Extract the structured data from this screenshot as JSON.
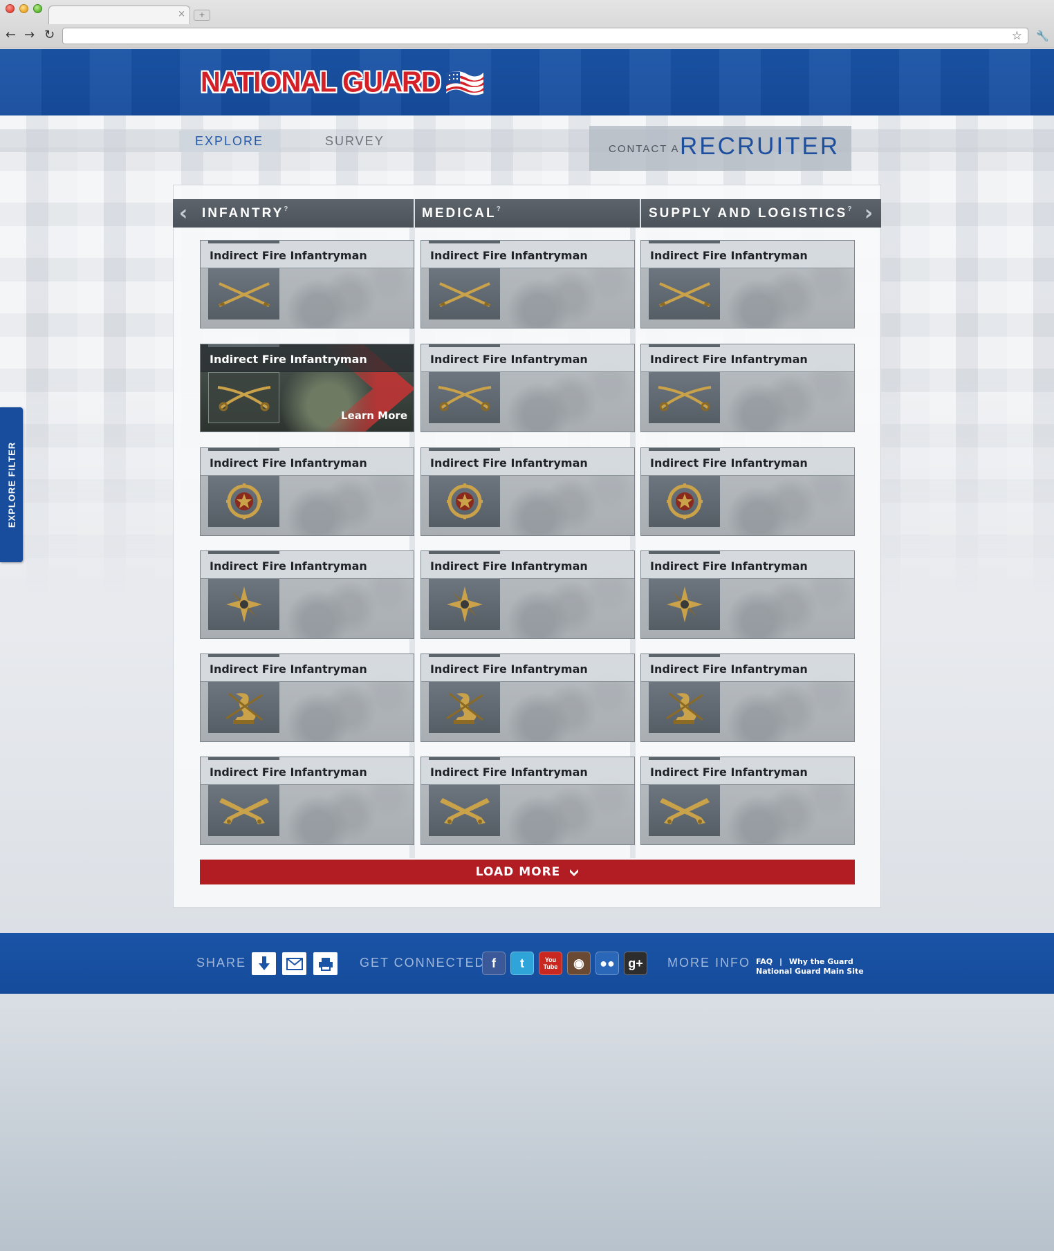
{
  "browser": {
    "tab_close": "×",
    "new_tab": "+",
    "nav_back": "←",
    "nav_forward": "→",
    "nav_reload": "↻",
    "bookmark": "☆",
    "wrench": "🔧"
  },
  "brand": {
    "logo_text": "NATIONAL GUARD",
    "red": "#d42027",
    "blue": "#1a54a6"
  },
  "nav": {
    "explore": "EXPLORE",
    "survey": "SURVEY",
    "contact_prefix": "CONTACT A",
    "recruiter": "RECRUITER"
  },
  "side_tab": {
    "label": "EXPLORE FILTER"
  },
  "categories": [
    {
      "label": "INFANTRY",
      "help": "?"
    },
    {
      "label": "MEDICAL",
      "help": "?"
    },
    {
      "label": "SUPPLY AND LOGISTICS",
      "help": "?"
    }
  ],
  "arrows": {
    "prev": "‹",
    "next": "›"
  },
  "cards": {
    "title": "Indirect Fire Infantryman",
    "active_learn_more": "Learn More",
    "rows": [
      {
        "icon": "crossed-rifles-icon"
      },
      {
        "icon": "crossed-sabers-icon"
      },
      {
        "icon": "ordnance-wheel-insignia-icon"
      },
      {
        "icon": "compass-star-insignia-icon"
      },
      {
        "icon": "signal-corps-insignia-icon"
      },
      {
        "icon": "crossed-pistols-icon"
      }
    ]
  },
  "load_more": {
    "label": "LOAD MORE",
    "icon": "chevron-down-icon"
  },
  "footer": {
    "share": "SHARE",
    "get_connected": "GET CONNECTED",
    "more_info": "MORE INFO",
    "links": {
      "faq": "FAQ",
      "sep": "|",
      "why": "Why the Guard",
      "main": "National Guard Main Site"
    },
    "social": [
      {
        "name": "facebook-icon",
        "glyph": "f",
        "color": "#3b5998"
      },
      {
        "name": "twitter-icon",
        "glyph": "t",
        "color": "#2fa4d9"
      },
      {
        "name": "youtube-icon",
        "glyph": "You Tube",
        "color": "#c8281f"
      },
      {
        "name": "instagram-icon",
        "glyph": "◉",
        "color": "#6a4a33"
      },
      {
        "name": "myspace-icon",
        "glyph": "●●",
        "color": "#2a67b8"
      },
      {
        "name": "google-plus-icon",
        "glyph": "g+",
        "color": "#2d2d2d"
      }
    ]
  }
}
